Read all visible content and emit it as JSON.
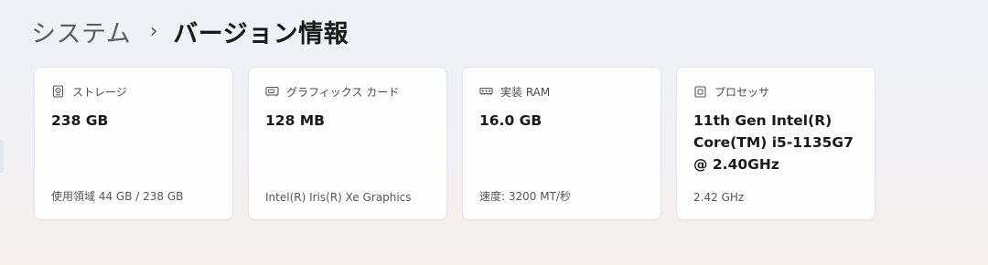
{
  "breadcrumb": {
    "parent": "システム",
    "separator": "›",
    "current": "バージョン情報"
  },
  "cards": [
    {
      "icon": "storage-drive-icon",
      "label": "ストレージ",
      "value": "238 GB",
      "detail": "使用領域 44 GB / 238 GB"
    },
    {
      "icon": "graphics-card-icon",
      "label": "グラフィックス カード",
      "value": "128 MB",
      "detail": "Intel(R) Iris(R) Xe Graphics"
    },
    {
      "icon": "memory-ram-icon",
      "label": "実装 RAM",
      "value": "16.0 GB",
      "detail": "速度: 3200 MT/秒"
    },
    {
      "icon": "processor-chip-icon",
      "label": "プロセッサ",
      "value": "11th Gen Intel(R) Core(TM) i5-1135G7 @ 2.40GHz",
      "detail": "2.42 GHz"
    }
  ]
}
